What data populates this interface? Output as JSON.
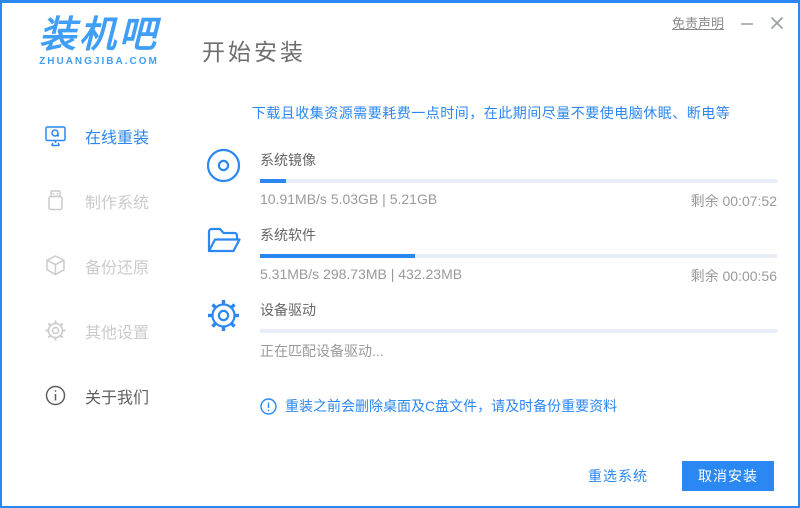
{
  "window": {
    "logo_text": "装机吧",
    "logo_subtext": "ZHUANGJIBA.COM",
    "disclaimer_label": "免责声明"
  },
  "header": {
    "title": "开始安装"
  },
  "sidebar": {
    "items": [
      {
        "label": "在线重装",
        "icon": "monitor-icon",
        "state": "active"
      },
      {
        "label": "制作系统",
        "icon": "usb-icon",
        "state": "disabled"
      },
      {
        "label": "备份还原",
        "icon": "backup-cube-icon",
        "state": "disabled"
      },
      {
        "label": "其他设置",
        "icon": "gear-icon",
        "state": "disabled"
      },
      {
        "label": "关于我们",
        "icon": "info-icon",
        "state": "normal"
      }
    ]
  },
  "main": {
    "notice": "下载且收集资源需要耗费一点时间，在此期间尽量不要使电脑休眠、断电等",
    "tasks": [
      {
        "title": "系统镜像",
        "icon": "disc-icon",
        "progress_percent": 5,
        "stats": "10.91MB/s 5.03GB | 5.21GB",
        "remaining": "剩余 00:07:52"
      },
      {
        "title": "系统软件",
        "icon": "folder-icon",
        "progress_percent": 30,
        "stats": "5.31MB/s 298.73MB | 432.23MB",
        "remaining": "剩余 00:00:56"
      },
      {
        "title": "设备驱动",
        "icon": "gear-icon",
        "progress_percent": 0,
        "stats": "正在匹配设备驱动...",
        "remaining": ""
      }
    ],
    "warning_note": "重装之前会删除桌面及C盘文件，请及时备份重要资料"
  },
  "footer": {
    "reselect_label": "重选系统",
    "cancel_label": "取消安装"
  },
  "colors": {
    "primary": "#2b87f2",
    "logo_blue": "#3f9ef7",
    "progress_track": "#e7eef7",
    "disabled_text": "#cbcbcb",
    "stats_text": "#9a9a9a"
  }
}
